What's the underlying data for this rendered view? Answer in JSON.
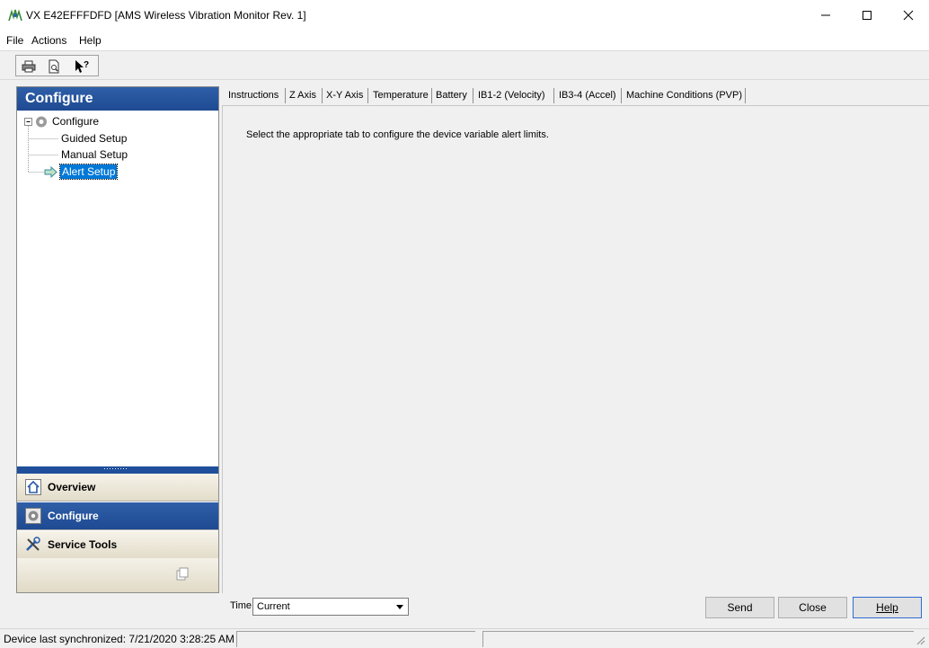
{
  "window": {
    "title": "VX E42EFFFDFD [AMS Wireless Vibration Monitor Rev. 1]",
    "minimize_glyph": "—",
    "maximize_glyph": "☐",
    "close_glyph": "✕"
  },
  "menu": {
    "file": "File",
    "actions": "Actions",
    "help": "Help"
  },
  "toolbar": {
    "icons": [
      "printer-icon",
      "print-preview-icon",
      "context-help-icon"
    ]
  },
  "nav": {
    "header": "Configure",
    "tree": {
      "root": "Configure",
      "items": [
        "Guided Setup",
        "Manual Setup",
        "Alert Setup"
      ],
      "selected_index": 2
    },
    "buttons": [
      "Overview",
      "Configure",
      "Service Tools"
    ],
    "active_button": "Configure"
  },
  "tabs": [
    "Instructions",
    "Z Axis",
    "X-Y Axis",
    "Temperature",
    "Battery",
    "IB1-2 (Velocity)",
    "IB3-4 (Accel)",
    "Machine Conditions (PVP)"
  ],
  "active_tab": "Instructions",
  "content": {
    "instructions": "Select the appropriate tab to configure the device variable alert limits."
  },
  "footer": {
    "time_label": "Time:",
    "time_value": "Current",
    "send": "Send",
    "close": "Close",
    "help": "Help"
  },
  "status": {
    "text": "Device last synchronized: 7/21/2020 3:28:25 AM"
  },
  "colors": {
    "accent_blue": "#1e4a92",
    "selection": "#0078d7"
  }
}
